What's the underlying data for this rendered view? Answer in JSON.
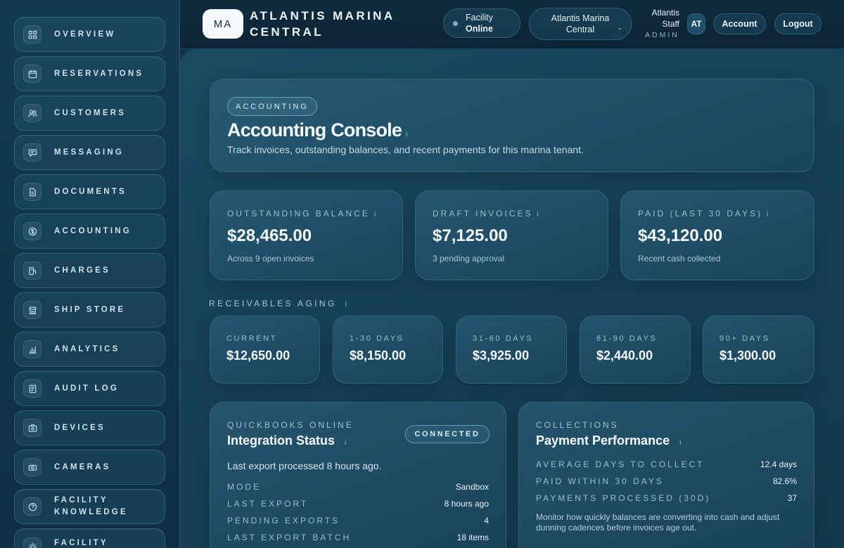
{
  "sidebar": {
    "items": [
      {
        "label": "Overview",
        "icon": "grid-icon"
      },
      {
        "label": "Reservations",
        "icon": "calendar-icon"
      },
      {
        "label": "Customers",
        "icon": "users-icon"
      },
      {
        "label": "Messaging",
        "icon": "chat-icon"
      },
      {
        "label": "Documents",
        "icon": "document-icon"
      },
      {
        "label": "Accounting",
        "icon": "dollar-icon"
      },
      {
        "label": "Charges",
        "icon": "fuel-icon"
      },
      {
        "label": "Ship Store",
        "icon": "store-icon"
      },
      {
        "label": "Analytics",
        "icon": "chart-icon"
      },
      {
        "label": "Audit Log",
        "icon": "log-icon"
      },
      {
        "label": "Devices",
        "icon": "device-icon"
      },
      {
        "label": "Cameras",
        "icon": "camera-icon"
      },
      {
        "label": "Facility Knowledge",
        "icon": "help-icon"
      },
      {
        "label": "Facility",
        "icon": "sun-icon"
      }
    ]
  },
  "header": {
    "logo_initials": "MA",
    "brand_line1": "ATLANTIS MARINA",
    "brand_line2": "CENTRAL",
    "status_line1": "Facility",
    "status_line2": "Online",
    "facility_select_line1": "Atlantis Marina",
    "facility_select_line2": "Central",
    "user_name_line1": "Atlantis",
    "user_name_line2": "Staff",
    "user_role": "ADMIN",
    "avatar_initials": "AT",
    "account_label": "Account",
    "logout_label": "Logout"
  },
  "hero": {
    "badge": "ACCOUNTING",
    "title": "Accounting Console",
    "info": "i",
    "subtitle": "Track invoices, outstanding balances, and recent payments for this marina tenant."
  },
  "stats": [
    {
      "label": "OUTSTANDING BALANCE",
      "value": "$28,465.00",
      "note": "Across 9 open invoices"
    },
    {
      "label": "DRAFT INVOICES",
      "value": "$7,125.00",
      "note": "3 pending approval"
    },
    {
      "label": "PAID (LAST 30 DAYS)",
      "value": "$43,120.00",
      "note": "Recent cash collected"
    }
  ],
  "aging": {
    "title": "RECEIVABLES AGING",
    "buckets": [
      {
        "label": "CURRENT",
        "value": "$12,650.00"
      },
      {
        "label": "1-30 DAYS",
        "value": "$8,150.00"
      },
      {
        "label": "31-60 DAYS",
        "value": "$3,925.00"
      },
      {
        "label": "61-90 DAYS",
        "value": "$2,440.00"
      },
      {
        "label": "90+ DAYS",
        "value": "$1,300.00"
      }
    ]
  },
  "integration": {
    "provider": "QUICKBOOKS ONLINE",
    "title": "Integration Status",
    "status": "CONNECTED",
    "message": "Last export processed 8 hours ago.",
    "rows": [
      {
        "key": "MODE",
        "value": "Sandbox"
      },
      {
        "key": "LAST EXPORT",
        "value": "8 hours ago"
      },
      {
        "key": "PENDING EXPORTS",
        "value": "4"
      },
      {
        "key": "LAST EXPORT BATCH",
        "value": "18 items"
      }
    ]
  },
  "collections": {
    "label": "COLLECTIONS",
    "title": "Payment Performance",
    "rows": [
      {
        "key": "AVERAGE DAYS TO COLLECT",
        "value": "12.4 days"
      },
      {
        "key": "PAID WITHIN 30 DAYS",
        "value": "82.6%"
      },
      {
        "key": "PAYMENTS PROCESSED (30D)",
        "value": "37"
      }
    ],
    "description": "Monitor how quickly balances are converting into cash and adjust dunning cadences before invoices age out."
  },
  "colors": {
    "accent": "#6aa4b8",
    "background": "#174159",
    "status_dot": "#8ea8b4"
  }
}
